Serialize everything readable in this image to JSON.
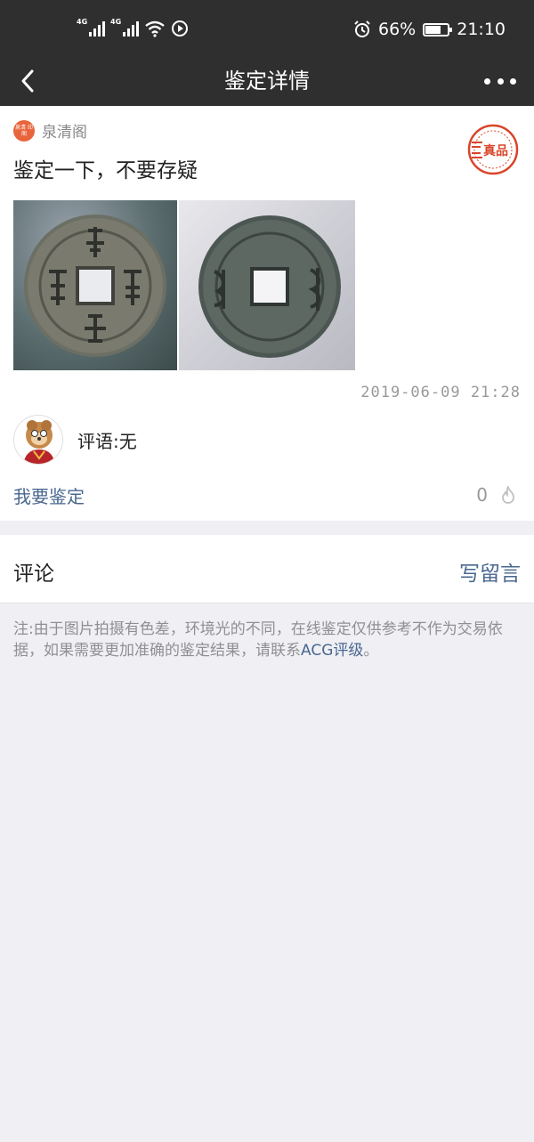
{
  "status_bar": {
    "network_1": "4G",
    "network_2": "4G",
    "battery_percent": "66%",
    "time": "21:10"
  },
  "nav": {
    "title": "鉴定详情"
  },
  "post": {
    "author_logo_text": "泉清 印阁",
    "author_name": "泉清阁",
    "title": "鉴定一下，不要存疑",
    "stamp_text": "真品",
    "timestamp": "2019-06-09  21:28",
    "remark": "评语:无",
    "appraise_label": "我要鉴定",
    "likes_count": "0"
  },
  "comments": {
    "title": "评论",
    "write_label": "写留言"
  },
  "disclaimer": {
    "text": "注:由于图片拍摄有色差，环境光的不同，在线鉴定仅供参考不作为交易依据，如果需要更加准确的鉴定结果，请联系",
    "link": "ACG评级",
    "suffix": "。"
  },
  "colors": {
    "bar_bg": "#2f2f2f",
    "link_blue": "#4a6790",
    "stamp_red": "#d9452b",
    "page_bg": "#efeff4"
  },
  "icons": [
    "back-icon",
    "more-icon",
    "alarm-icon",
    "wifi-icon",
    "battery-icon",
    "flame-icon"
  ]
}
